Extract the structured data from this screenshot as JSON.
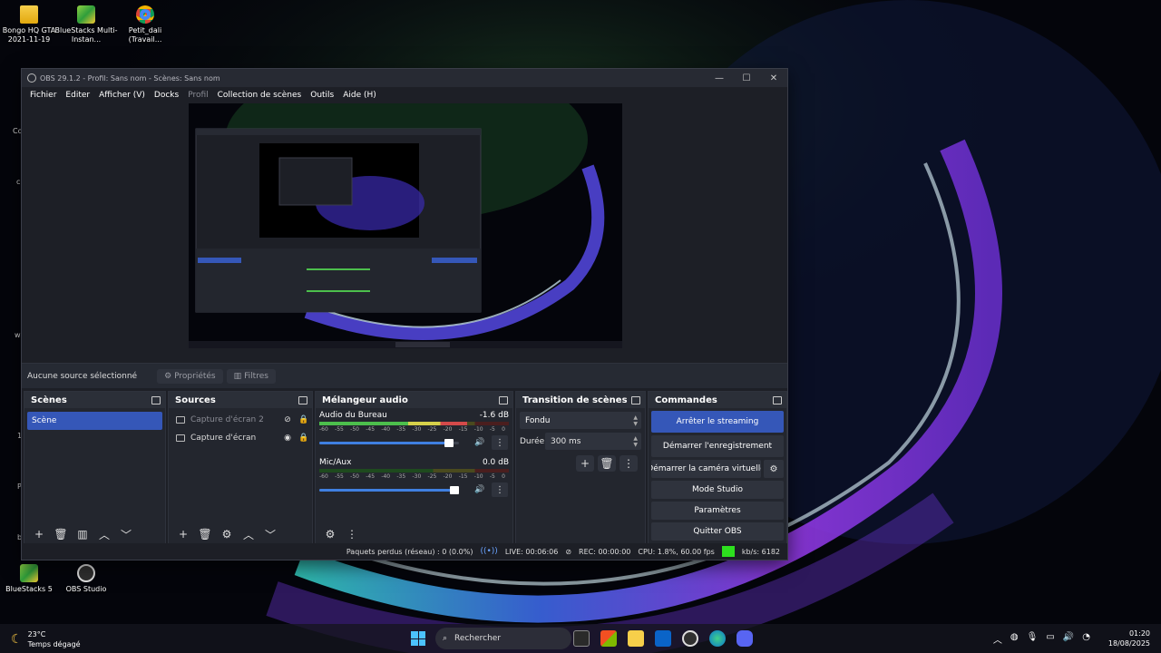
{
  "desktop": {
    "icons": [
      {
        "label": "Bongo HQ GTA 2021-11-19",
        "icon": "folder-icon"
      },
      {
        "label": "BlueStacks Multi-Instan...",
        "icon": "bluestacks-icon"
      },
      {
        "label": "Petit_dali (Travail...",
        "icon": "chrome-icon"
      },
      {
        "label": "BlueStacks 5",
        "icon": "bluestacks-icon"
      },
      {
        "label": "OBS Studio",
        "icon": "obs-icon"
      }
    ],
    "left_fragments": [
      "Co",
      "cl",
      "wi",
      "1",
      "P",
      "b"
    ]
  },
  "obs": {
    "title": "OBS 29.1.2 - Profil: Sans nom - Scènes: Sans nom",
    "window_controls": [
      "—",
      "☐",
      "✕"
    ],
    "menu": [
      "Fichier",
      "Editer",
      "Afficher (V)",
      "Docks",
      "Profil",
      "Collection de scènes",
      "Outils",
      "Aide (H)"
    ],
    "source_bar": {
      "no_source": "Aucune source sélectionné",
      "properties": "Propriétés",
      "filters": "Filtres"
    },
    "scenes": {
      "title": "Scènes",
      "items": [
        "Scène"
      ]
    },
    "sources": {
      "title": "Sources",
      "items": [
        {
          "name": "Capture d'écran 2",
          "visible": false,
          "locked": true
        },
        {
          "name": "Capture d'écran",
          "visible": true,
          "locked": true
        }
      ]
    },
    "mixer": {
      "title": "Mélangeur audio",
      "scale": [
        "-60",
        "-55",
        "-50",
        "-45",
        "-40",
        "-35",
        "-30",
        "-25",
        "-20",
        "-15",
        "-10",
        "-5",
        "0"
      ],
      "channels": [
        {
          "name": "Audio du Bureau",
          "db": "-1.6 dB",
          "level": 0.78,
          "fader": 0.96
        },
        {
          "name": "Mic/Aux",
          "db": "0.0 dB",
          "level": 0.0,
          "fader": 1.0
        }
      ]
    },
    "transitions": {
      "title": "Transition de scènes",
      "selected": "Fondu",
      "duration_label": "Durée",
      "duration_value": "300 ms"
    },
    "controls": {
      "title": "Commandes",
      "stop_streaming": "Arrêter le streaming",
      "start_recording": "Démarrer l'enregistrement",
      "virtual_cam": "Démarrer la caméra virtuelle",
      "studio_mode": "Mode Studio",
      "settings": "Paramètres",
      "quit": "Quitter OBS"
    },
    "status": {
      "dropped": "Paquets perdus (réseau) : 0 (0.0%)",
      "live": "LIVE: 00:06:06",
      "rec": "REC: 00:00:00",
      "cpu": "CPU: 1.8%, 60.00 fps",
      "kbs": "kb/s: 6182"
    }
  },
  "taskbar": {
    "weather_temp": "23°C",
    "weather_desc": "Temps dégagé",
    "search_placeholder": "Rechercher",
    "time": "01:20",
    "date": "18/08/2025"
  }
}
